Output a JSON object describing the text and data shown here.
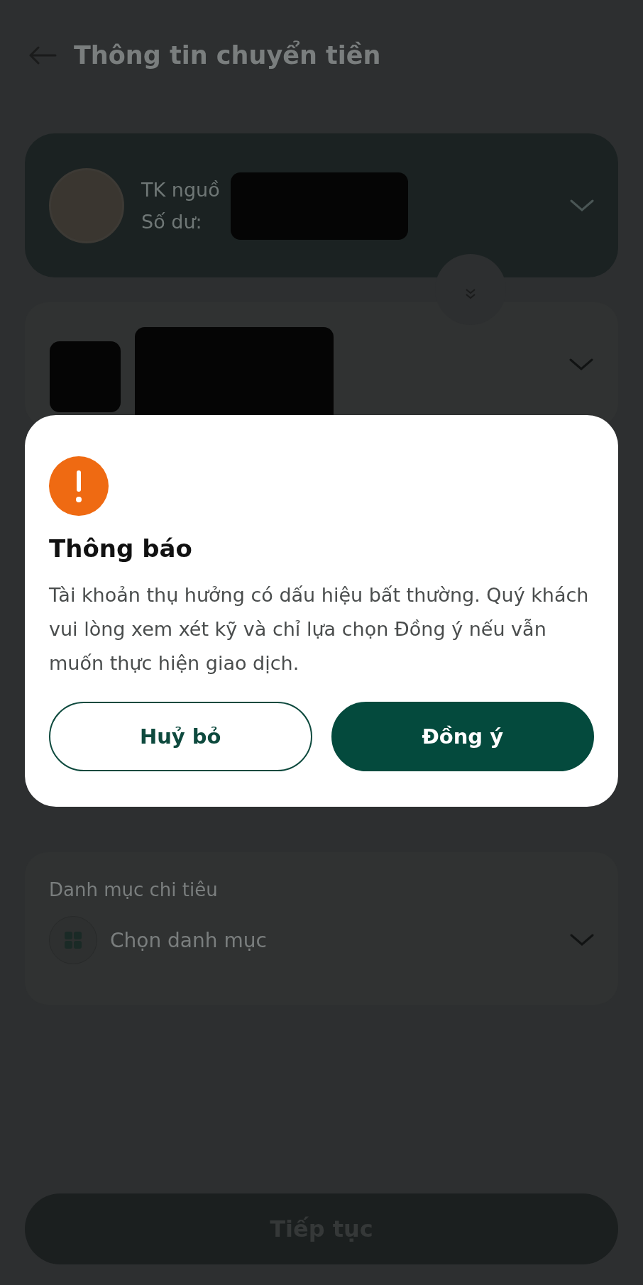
{
  "header": {
    "title": "Thông tin chuyển tiền"
  },
  "source_account": {
    "label": "TK nguồ",
    "balance_label": "Số dư:"
  },
  "category": {
    "label": "Danh mục chi tiêu",
    "placeholder": "Chọn danh mục"
  },
  "continue_button": {
    "label": "Tiếp tục"
  },
  "dialog": {
    "title": "Thông báo",
    "message": "Tài khoản thụ hưởng có dấu hiệu bất thường. Quý khách vui lòng xem xét kỹ và chỉ lựa chọn Đồng ý nếu vẫn muốn thực hiện giao dịch.",
    "buttons": [
      {
        "label": "Huỷ bỏ",
        "kind": "secondary"
      },
      {
        "label": "Đồng ý",
        "kind": "primary"
      }
    ]
  }
}
